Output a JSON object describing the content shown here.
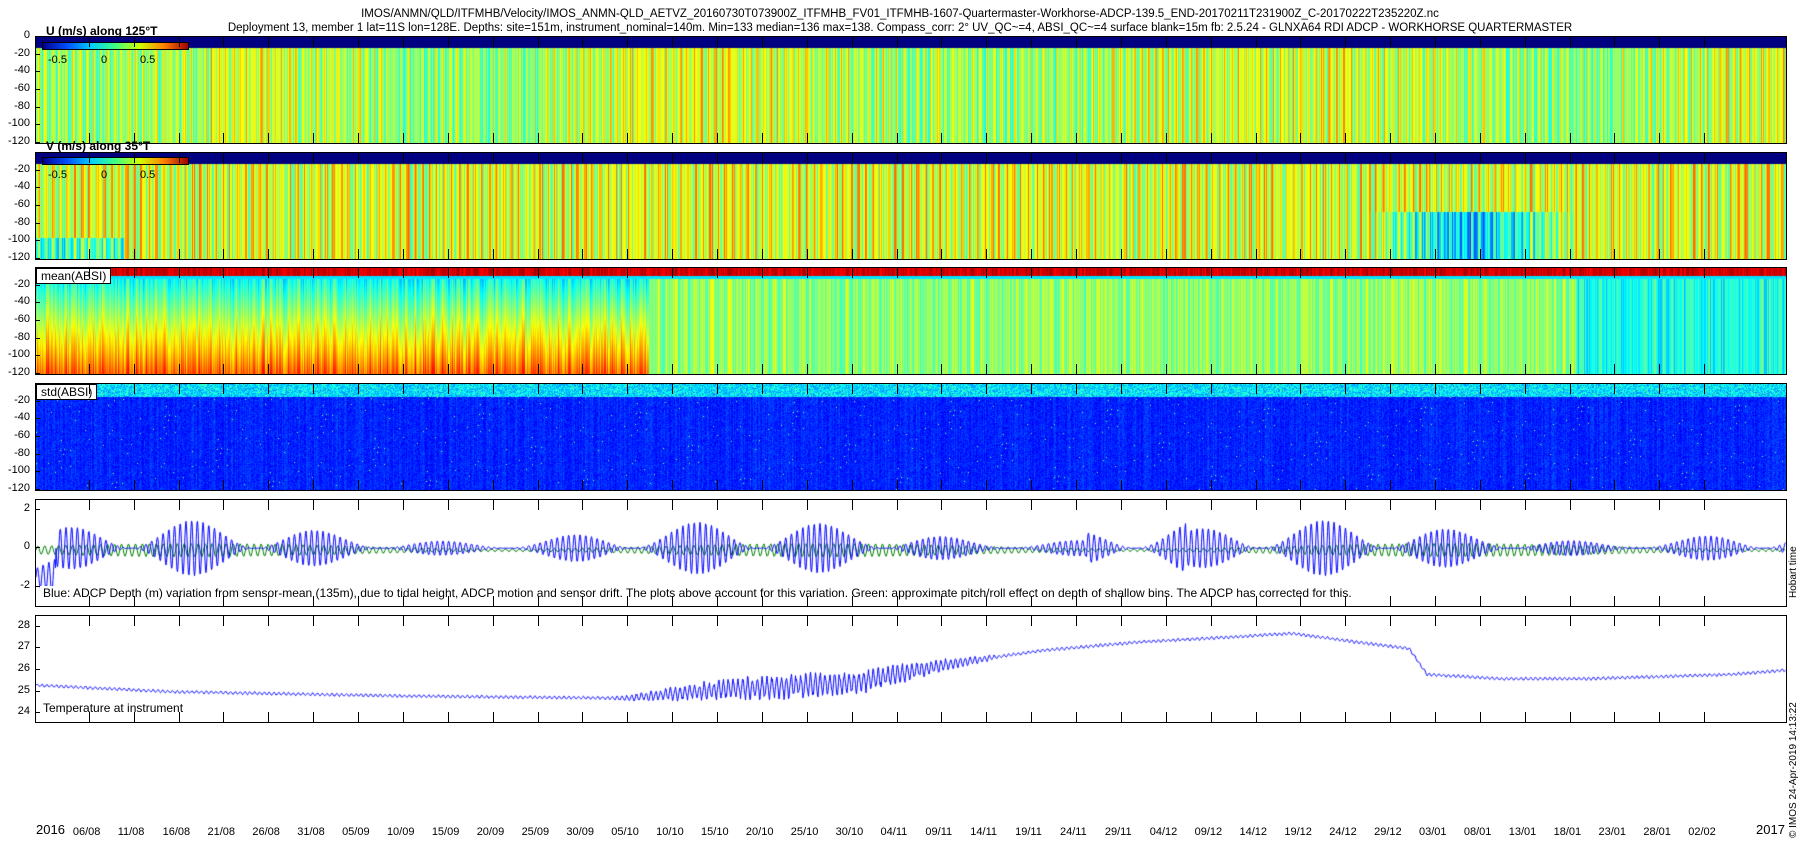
{
  "header": {
    "line1": "IMOS/ANMN/QLD/ITFMHB/Velocity/IMOS_ANMN-QLD_AETVZ_20160730T073900Z_ITFMHB_FV01_ITFMHB-1607-Quartermaster-Workhorse-ADCP-139.5_END-20170211T231900Z_C-20170222T235220Z.nc",
    "line2": "Deployment 13, member 1 lat=11S lon=128E. Depths: site=151m, instrument_nominal=140m. Min=133 median=136 max=138. Compass_corr: 2° UV_QC~=4, ABSI_QC~=4 surface blank=15m fb: 2.5.24 - GLNXA64 RDI ADCP - WORKHORSE QUARTERMASTER"
  },
  "panels": {
    "u": {
      "label": "U (m/s) along 125°T",
      "cb_ticks": [
        "-0.5",
        "0",
        "0.5"
      ]
    },
    "v": {
      "label": "V (m/s) along 35°T",
      "cb_ticks": [
        "-0.5",
        "0",
        "0.5"
      ]
    },
    "mean": {
      "label": "mean(ABSI)"
    },
    "std": {
      "label": "std(ABSI)"
    },
    "depth": {
      "note": "Blue: ADCP Depth (m) variation from sensor-mean (135m), due to tidal height, ADCP motion and sensor drift. The plots above account for this variation. Green: approximate pitch/roll effect on depth of shallow bins. The ADCP has corrected for this."
    },
    "temp": {
      "note": "Temperature at instrument"
    }
  },
  "side_labels": {
    "time_zone": "Hobart time",
    "credit": "© IMOS 24-Apr-2019 14:13:22"
  },
  "colors": {
    "blue_line": "#0000ff",
    "green_line": "#008000"
  },
  "chart_data": [
    {
      "type": "heatmap",
      "title": "U (m/s) along 125°T",
      "ylim": [
        -120,
        0
      ],
      "yticks": [
        0,
        -20,
        -40,
        -60,
        -80,
        -100,
        -120
      ],
      "clim": [
        -0.7,
        0.7
      ],
      "colormap": "jet",
      "description_values": {
        "typical": 0.2,
        "range": [
          -0.5,
          0.6
        ]
      }
    },
    {
      "type": "heatmap",
      "title": "V (m/s) along 35°T",
      "ylim": [
        -120,
        0
      ],
      "yticks": [
        -20,
        -40,
        -60,
        -80,
        -100,
        -120
      ],
      "clim": [
        -0.7,
        0.7
      ],
      "colormap": "jet"
    },
    {
      "type": "heatmap",
      "title": "mean(ABSI)",
      "ylim": [
        -120,
        0
      ],
      "yticks": [
        -20,
        -40,
        -60,
        -80,
        -100,
        -120
      ],
      "colormap": "jet"
    },
    {
      "type": "heatmap",
      "title": "std(ABSI)",
      "ylim": [
        -120,
        0
      ],
      "yticks": [
        -20,
        -40,
        -60,
        -80,
        -100,
        -120
      ],
      "colormap": "jet"
    },
    {
      "type": "line",
      "ylim": [
        -3,
        2.5
      ],
      "yticks": [
        2,
        0,
        -2
      ],
      "series": [
        {
          "color": "#0000ff",
          "amplitude": 1.2
        },
        {
          "color": "#008000",
          "amplitude": 0.35
        }
      ]
    },
    {
      "type": "line",
      "ylim": [
        23.6,
        28.5
      ],
      "yticks": [
        28,
        27,
        26,
        25,
        24
      ],
      "series": [
        {
          "color": "#0000ff",
          "x": [
            "2016-07-31",
            "2016-08-15",
            "2016-09-10",
            "2016-10-05",
            "2016-10-15",
            "2016-10-30",
            "2016-11-10",
            "2016-11-20",
            "2016-12-01",
            "2016-12-10",
            "2016-12-18",
            "2016-12-25",
            "2016-12-31",
            "2017-01-02",
            "2017-01-10",
            "2017-01-20",
            "2017-02-05",
            "2017-02-11"
          ],
          "values": [
            25.3,
            25.0,
            24.8,
            24.7,
            25.1,
            25.4,
            26.3,
            26.9,
            27.3,
            27.5,
            27.7,
            27.3,
            27.0,
            25.8,
            25.6,
            25.6,
            25.8,
            26.0
          ]
        }
      ]
    }
  ],
  "xaxis": {
    "start_year": "2016",
    "end_year": "2017",
    "ticks": [
      "06/08",
      "11/08",
      "16/08",
      "21/08",
      "26/08",
      "31/08",
      "05/09",
      "10/09",
      "15/09",
      "20/09",
      "25/09",
      "30/09",
      "05/10",
      "10/10",
      "15/10",
      "20/10",
      "25/10",
      "30/10",
      "04/11",
      "09/11",
      "14/11",
      "19/11",
      "24/11",
      "29/11",
      "04/12",
      "09/12",
      "14/12",
      "19/12",
      "24/12",
      "29/12",
      "03/01",
      "08/01",
      "13/01",
      "18/01",
      "23/01",
      "28/01",
      "02/02"
    ]
  }
}
